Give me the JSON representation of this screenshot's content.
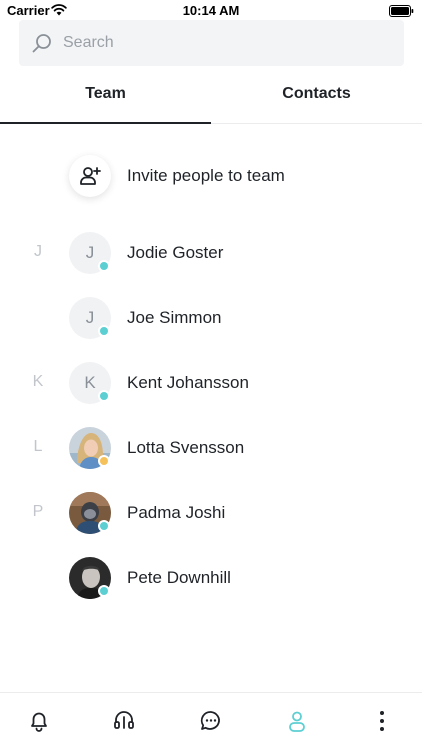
{
  "status_bar": {
    "carrier": "Carrier",
    "time": "10:14 AM"
  },
  "search": {
    "placeholder": "Search"
  },
  "tabs": [
    {
      "label": "Team",
      "active": true
    },
    {
      "label": "Contacts",
      "active": false
    }
  ],
  "invite": {
    "label": "Invite people to team"
  },
  "contacts": [
    {
      "section": "J",
      "initial": "J",
      "name": "Jodie Goster",
      "status_color": "#5ccfd2",
      "avatar": "initial"
    },
    {
      "section": "",
      "initial": "J",
      "name": "Joe Simmon",
      "status_color": "#5ccfd2",
      "avatar": "initial"
    },
    {
      "section": "K",
      "initial": "K",
      "name": "Kent Johansson",
      "status_color": "#5ccfd2",
      "avatar": "initial"
    },
    {
      "section": "L",
      "initial": "",
      "name": "Lotta Svensson",
      "status_color": "#f5c15a",
      "avatar": "photo"
    },
    {
      "section": "P",
      "initial": "",
      "name": "Padma Joshi",
      "status_color": "#5ccfd2",
      "avatar": "photo"
    },
    {
      "section": "",
      "initial": "",
      "name": "Pete Downhill",
      "status_color": "#5ccfd2",
      "avatar": "photo"
    }
  ],
  "bottom_nav": [
    {
      "icon": "bell-icon",
      "active": false
    },
    {
      "icon": "headset-icon",
      "active": false
    },
    {
      "icon": "chat-icon",
      "active": false
    },
    {
      "icon": "person-icon",
      "active": true
    },
    {
      "icon": "more-icon",
      "active": false
    }
  ],
  "colors": {
    "accent": "#5ccfd2",
    "away": "#f5c15a",
    "text": "#1f2328",
    "muted": "#c2c6cc"
  }
}
